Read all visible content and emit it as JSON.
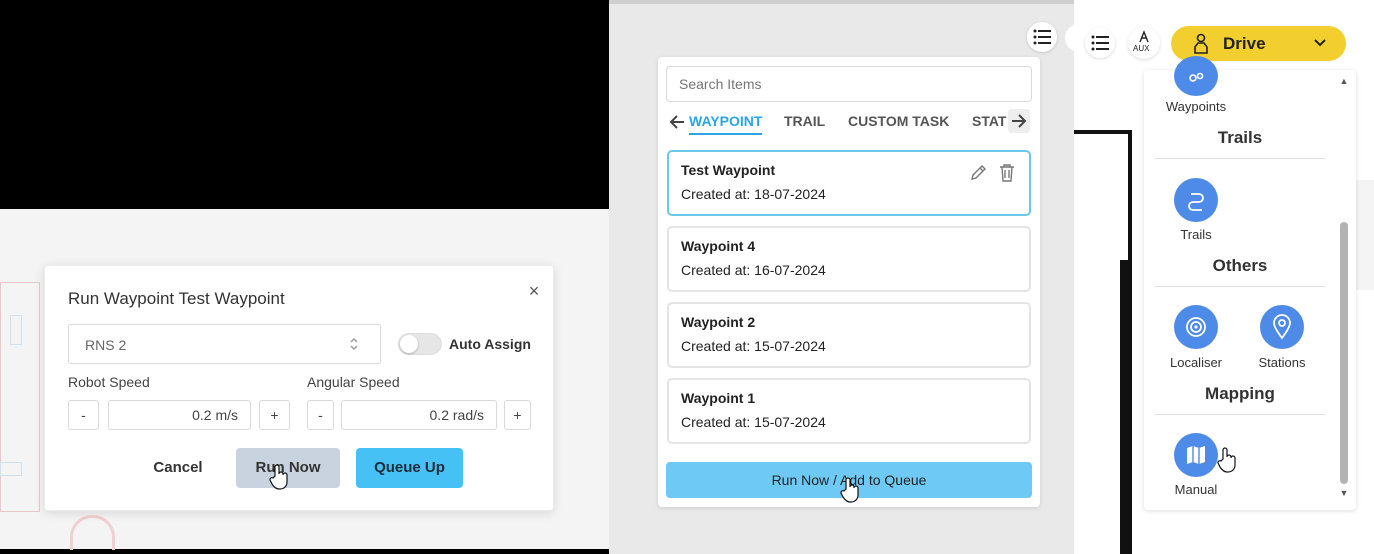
{
  "dialog": {
    "title": "Run Waypoint Test Waypoint",
    "robot_select": "RNS 2",
    "auto_assign_label": "Auto Assign",
    "robot_speed_label": "Robot Speed",
    "robot_speed_value": "0.2 m/s",
    "angular_speed_label": "Angular Speed",
    "angular_speed_value": "0.2 rad/s",
    "minus": "-",
    "plus": "+",
    "close": "×",
    "cancel": "Cancel",
    "run_now": "Run Now",
    "queue_up": "Queue Up"
  },
  "items": {
    "search_placeholder": "Search Items",
    "tabs": [
      "WAYPOINT",
      "TRAIL",
      "CUSTOM TASK",
      "STAT"
    ],
    "list": [
      {
        "title": "Test Waypoint",
        "created": "Created at: 18-07-2024"
      },
      {
        "title": "Waypoint 4",
        "created": "Created at: 16-07-2024"
      },
      {
        "title": "Waypoint 2",
        "created": "Created at: 15-07-2024"
      },
      {
        "title": "Waypoint 1",
        "created": "Created at: 15-07-2024"
      }
    ],
    "run_queue_label": "Run Now / Add to Queue"
  },
  "sidebar": {
    "drive_label": "Drive",
    "aux_label": "AUX",
    "waypoints_label": "Waypoints",
    "trails_section": "Trails",
    "trails_label": "Trails",
    "others_section": "Others",
    "localiser_label": "Localiser",
    "stations_label": "Stations",
    "mapping_section": "Mapping",
    "manual_label": "Manual"
  },
  "colors": {
    "accent_blue": "#2aa6e6",
    "button_blue": "#46c1f5",
    "drive_yellow": "#f2cf2f",
    "icon_blue": "#4e8be8"
  }
}
